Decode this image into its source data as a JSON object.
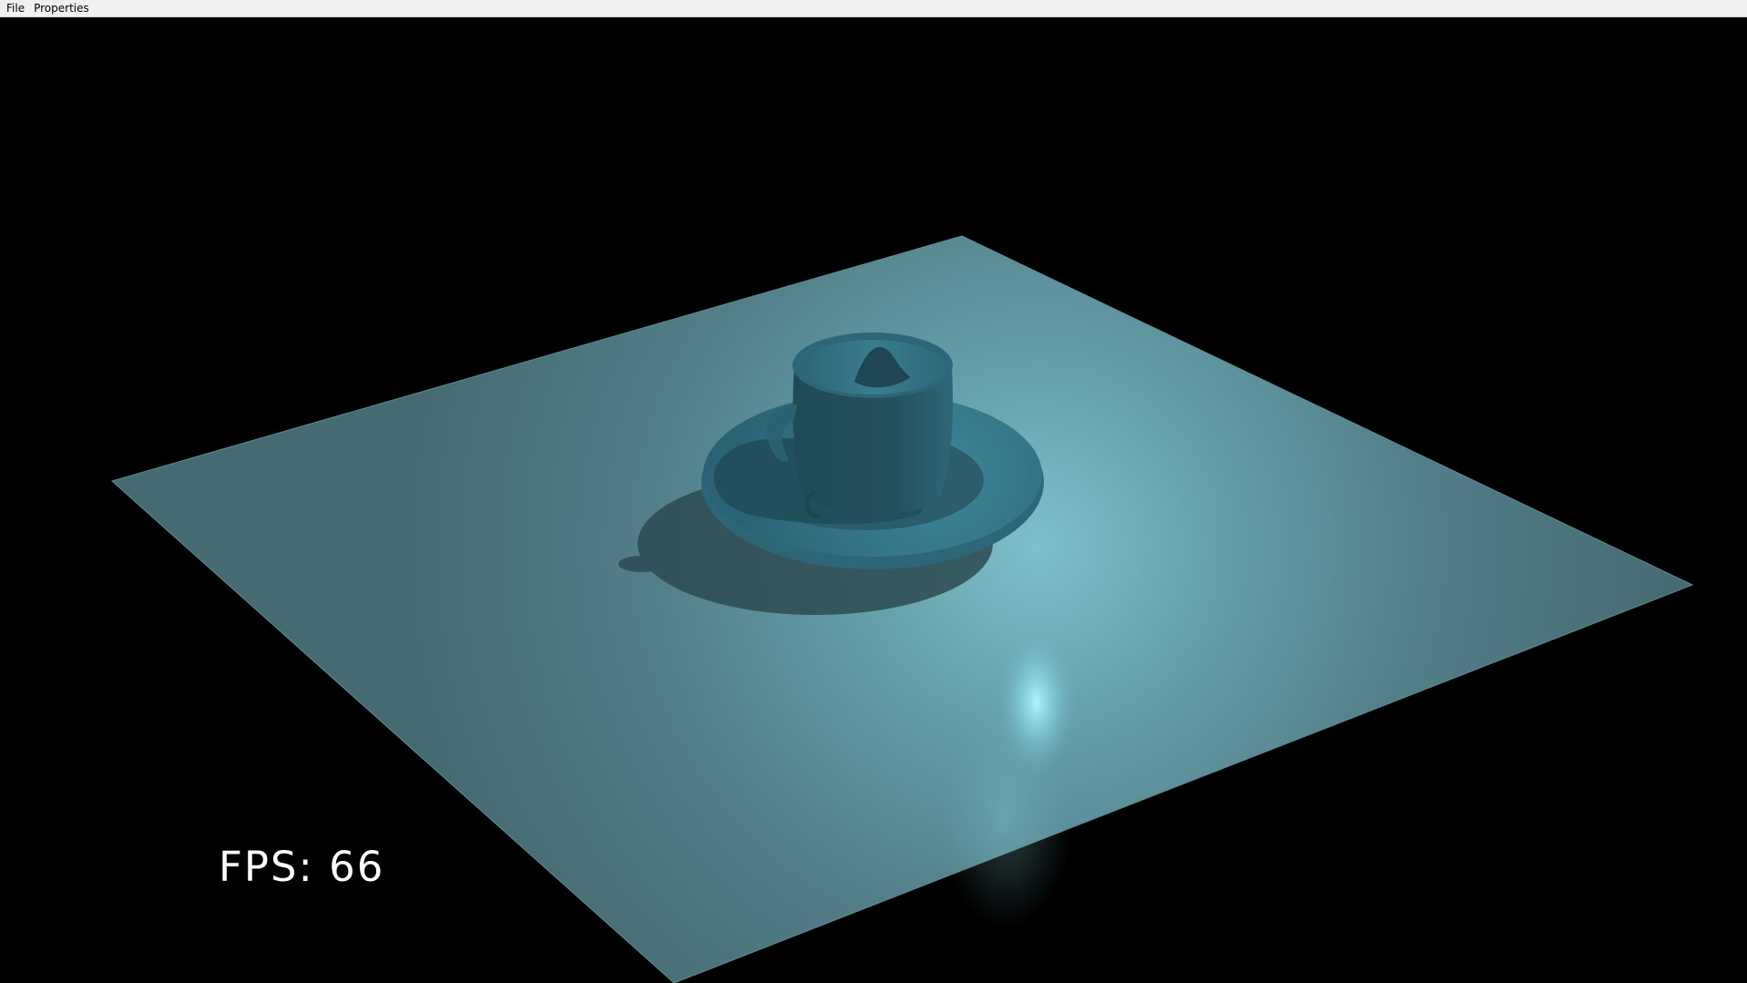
{
  "menu": {
    "file_label": "File",
    "properties_label": "Properties"
  },
  "hud": {
    "fps_label": "FPS:",
    "fps_value": "66"
  },
  "scene": {
    "background_color": "#000000",
    "plane_color": "#4e7d86",
    "object_color": "#2d6676",
    "light_highlight_color": "#9ef0fb"
  }
}
